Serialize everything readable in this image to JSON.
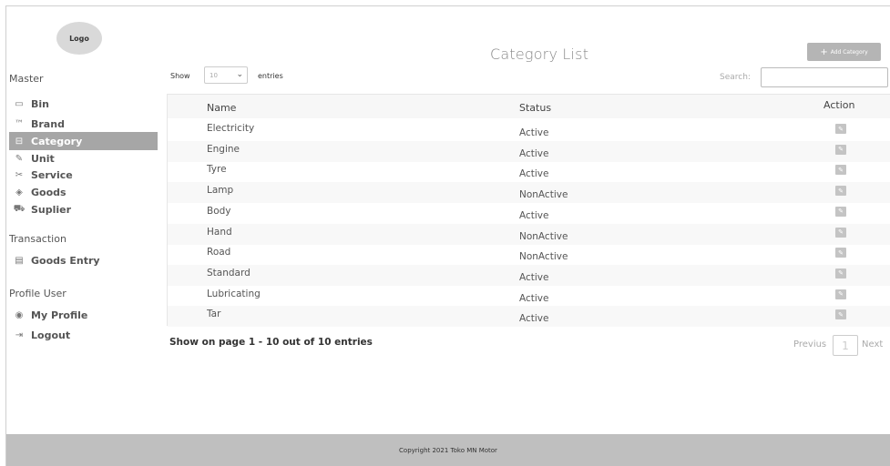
{
  "logo": {
    "label": "Logo"
  },
  "sidebar": {
    "master_title": "Master",
    "master_items": [
      {
        "label": "Bin",
        "icon": "bin-icon",
        "glyph": "▭"
      },
      {
        "label": "Brand",
        "icon": "brand-tag-icon",
        "glyph": "™"
      },
      {
        "label": "Category",
        "icon": "category-icon",
        "glyph": "⊟",
        "active": true
      },
      {
        "label": "Unit",
        "icon": "pen-icon",
        "glyph": "✎"
      },
      {
        "label": "Service",
        "icon": "tools-icon",
        "glyph": "✂"
      },
      {
        "label": "Goods",
        "icon": "cube-icon",
        "glyph": "◈"
      },
      {
        "label": "Suplier",
        "icon": "truck-icon",
        "glyph": "⛟"
      }
    ],
    "transaction_title": "Transaction",
    "transaction_items": [
      {
        "label": "Goods Entry",
        "icon": "clipboard-icon",
        "glyph": "▤"
      }
    ],
    "profile_title": "Profile User",
    "profile_items": [
      {
        "label": "My Profile",
        "icon": "user-icon",
        "glyph": "◉"
      },
      {
        "label": "Logout",
        "icon": "logout-icon",
        "glyph": "⇥"
      }
    ]
  },
  "main": {
    "title": "Category List",
    "add_button": "Add Category",
    "add_plus": "+",
    "show_label": "Show",
    "entries_value": "10",
    "entries_label": "entries",
    "search_label": "Search:",
    "columns": {
      "name": "Name",
      "status": "Status",
      "action": "Action"
    },
    "rows": [
      {
        "name": "Electricity",
        "status": "Active"
      },
      {
        "name": "Engine",
        "status": "Active"
      },
      {
        "name": "Tyre",
        "status": "Active"
      },
      {
        "name": "Lamp",
        "status": "NonActive"
      },
      {
        "name": "Body",
        "status": "Active"
      },
      {
        "name": "Hand",
        "status": "NonActive"
      },
      {
        "name": "Road",
        "status": "NonActive"
      },
      {
        "name": "Standard",
        "status": "Active"
      },
      {
        "name": "Lubricating",
        "status": "Active"
      },
      {
        "name": "Tar",
        "status": "Active"
      }
    ],
    "info": "Show on page 1 - 10 out of 10 entries",
    "pagination": {
      "prev": "Previus",
      "current": "1",
      "next": "Next"
    }
  },
  "footer": {
    "text": "Copyright 2021 Toko MN Motor"
  },
  "colors": {
    "active_nav": "#a6a6a6",
    "footer": "#bfbfbf",
    "button": "#b5b5b5"
  }
}
